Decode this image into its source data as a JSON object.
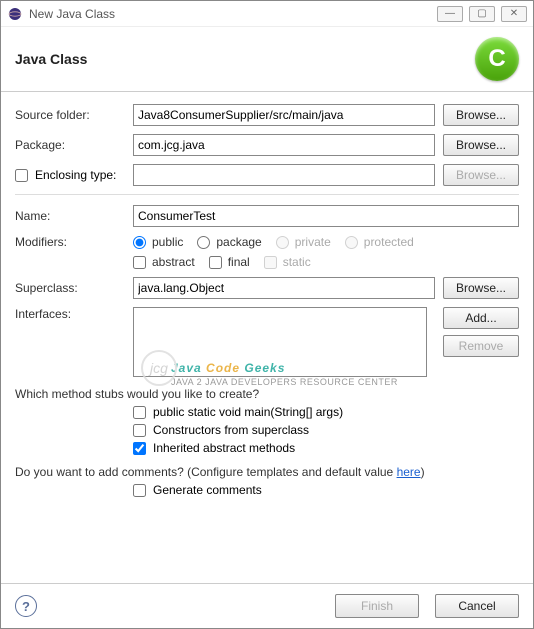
{
  "titlebar": {
    "title": "New Java Class"
  },
  "banner": {
    "title": "Java Class",
    "icon_letter": "C"
  },
  "sourceFolder": {
    "label": "Source folder:",
    "value": "Java8ConsumerSupplier/src/main/java",
    "browse": "Browse..."
  },
  "package": {
    "label": "Package:",
    "value": "com.jcg.java",
    "browse": "Browse..."
  },
  "enclosing": {
    "label": "Enclosing type:",
    "value": "",
    "browse": "Browse..."
  },
  "name": {
    "label": "Name:",
    "value": "ConsumerTest"
  },
  "modifiers": {
    "label": "Modifiers:",
    "public": "public",
    "package": "package",
    "private": "private",
    "protected": "protected",
    "abstract": "abstract",
    "final": "final",
    "static": "static"
  },
  "superclass": {
    "label": "Superclass:",
    "value": "java.lang.Object",
    "browse": "Browse..."
  },
  "interfaces": {
    "label": "Interfaces:",
    "add": "Add...",
    "remove": "Remove"
  },
  "stubs": {
    "question": "Which method stubs would you like to create?",
    "main": "public static void main(String[] args)",
    "constructors": "Constructors from superclass",
    "inherited": "Inherited abstract methods"
  },
  "comments": {
    "question_pre": "Do you want to add comments? (Configure templates and default value ",
    "here": "here",
    "question_post": ")",
    "generate": "Generate comments"
  },
  "footer": {
    "finish": "Finish",
    "cancel": "Cancel"
  },
  "watermark": {
    "line1a": "Java ",
    "line1b": "Code ",
    "line1c": "Geeks",
    "line2": "JAVA 2 JAVA DEVELOPERS RESOURCE CENTER",
    "circ": "jcg"
  }
}
